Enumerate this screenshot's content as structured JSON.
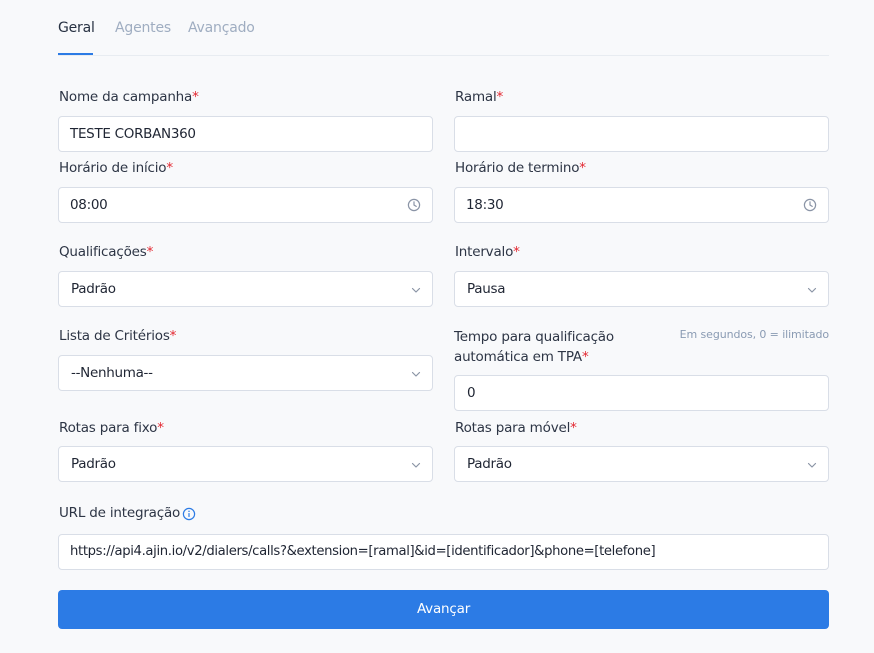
{
  "tabs": [
    {
      "label": "Geral",
      "active": true
    },
    {
      "label": "Agentes",
      "active": false
    },
    {
      "label": "Avançado",
      "active": false
    }
  ],
  "required_mark": "*",
  "form": {
    "campaign_name": {
      "label": "Nome da campanha",
      "value": "TESTE CORBAN360"
    },
    "extension": {
      "label": "Ramal",
      "value": ""
    },
    "start_time": {
      "label": "Horário de início",
      "value": "08:00"
    },
    "end_time": {
      "label": "Horário de termino",
      "value": "18:30"
    },
    "qualifications": {
      "label": "Qualificações",
      "value": "Padrão"
    },
    "interval": {
      "label": "Intervalo",
      "value": "Pausa"
    },
    "criteria_list": {
      "label": "Lista de Critérios",
      "value": "--Nenhuma--"
    },
    "tpa_time": {
      "label": "Tempo para qualificação automática em TPA",
      "hint": "Em segundos, 0 = ilimitado",
      "value": "0"
    },
    "landline_routes": {
      "label": "Rotas para fixo",
      "value": "Padrão"
    },
    "mobile_routes": {
      "label": "Rotas para móvel",
      "value": "Padrão"
    },
    "integration_url": {
      "label": "URL de integração",
      "value": "https://api4.ajin.io/v2/dialers/calls?&extension=[ramal]&id=[identificador]&phone=[telefone]"
    }
  },
  "submit_label": "Avançar",
  "colors": {
    "accent": "#2c7be5",
    "required": "#e3262f",
    "muted": "#9fadc1"
  }
}
